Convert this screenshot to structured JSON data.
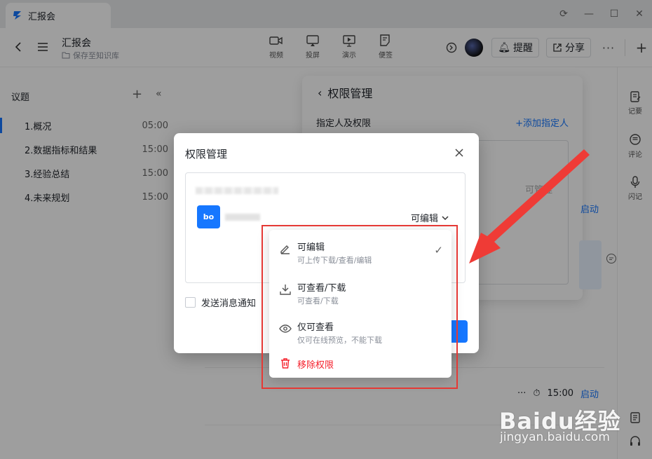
{
  "tab": {
    "title": "汇报会"
  },
  "doc": {
    "title": "汇报会",
    "subtitle": "保存至知识库"
  },
  "tools": [
    {
      "label": "视频",
      "icon": "video-icon"
    },
    {
      "label": "投屏",
      "icon": "cast-screen-icon"
    },
    {
      "label": "演示",
      "icon": "present-icon"
    },
    {
      "label": "便签",
      "icon": "note-icon"
    }
  ],
  "header_buttons": {
    "remind": "提醒",
    "share": "分享",
    "more": "···"
  },
  "sidebar": {
    "heading": "议题",
    "items": [
      {
        "label": "1.概况",
        "time": "05:00",
        "active": true
      },
      {
        "label": "2.数据指标和结果",
        "time": "15:00"
      },
      {
        "label": "3.经验总结",
        "time": "15:00"
      },
      {
        "label": "4.未来规划",
        "time": "15:00"
      }
    ]
  },
  "rightbar": [
    {
      "label": "记要",
      "icon": "record-icon"
    },
    {
      "label": "评论",
      "icon": "comment-icon"
    },
    {
      "label": "闪记",
      "icon": "mic-icon"
    }
  ],
  "perm_panel": {
    "title": "权限管理",
    "label": "指定人及权限",
    "add": "+添加指定人",
    "manage": "可管理",
    "auto_start": "启动"
  },
  "bottom_row": {
    "more": "···",
    "time": "15:00",
    "start": "启动"
  },
  "modal": {
    "title": "权限管理",
    "user_avatar": "bo",
    "perm_value": "可编辑",
    "notify_label": "发送消息通知"
  },
  "dropdown": {
    "items": [
      {
        "title": "可编辑",
        "desc": "可上传下载/查看/编辑",
        "icon": "edit-icon",
        "selected": true
      },
      {
        "title": "可查看/下载",
        "desc": "可查看/下载",
        "icon": "download-icon"
      },
      {
        "title": "仅可查看",
        "desc": "仅可在线预览，不能下载",
        "icon": "eye-icon"
      }
    ],
    "remove": "移除权限"
  },
  "watermark": {
    "main": "Baidu经验",
    "sub": "jingyan.baidu.com"
  },
  "colors": {
    "accent": "#1677ff",
    "danger": "#f5222d",
    "highlight": "#e53935"
  }
}
